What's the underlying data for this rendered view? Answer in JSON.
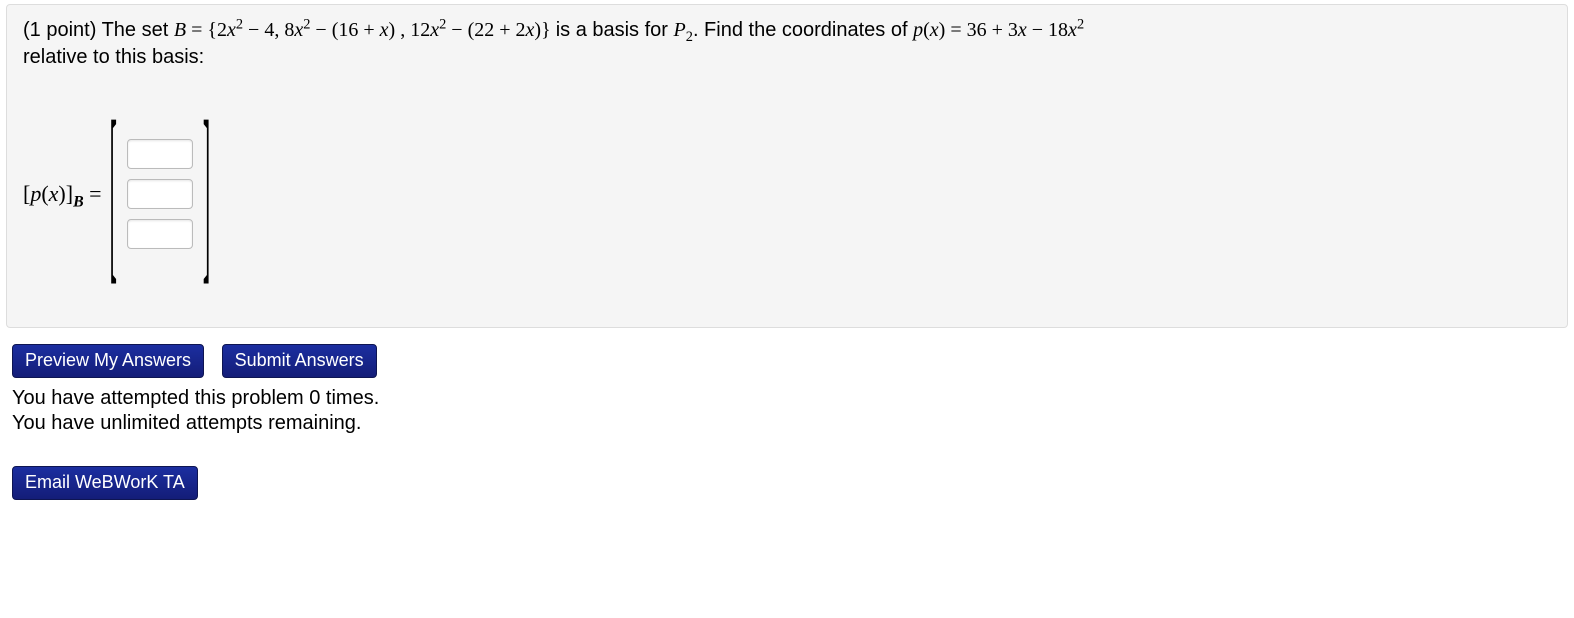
{
  "problem": {
    "points_prefix": "(1 point) ",
    "lead": "The set ",
    "B_eq": "B",
    "set_open": " = {",
    "b1_a": "2",
    "b1_b": " − 4,  ",
    "b2_a": "8",
    "b2_b": " − (16 + ",
    "b2_c": ") ,  ",
    "b3_a": "12",
    "b3_b": " − (22 + 2",
    "b3_c": ")",
    "set_close": "} ",
    "mid": "is a basis for ",
    "space": "P",
    "space_sub": "2",
    "mid2": ". Find the coordinates of ",
    "p_of_x": "p",
    "p_paren_x": "x",
    "eq": " = 36 + 3",
    "eq_x": "x",
    "eq_m": " − 18",
    "tail": " relative to this basis:",
    "vec_label_open": "[",
    "vec_label_p": "p",
    "vec_label_x": "x",
    "vec_label_close": "]",
    "vec_label_sub": "B",
    "vec_label_eq": " ="
  },
  "answers": {
    "c1": "",
    "c2": "",
    "c3": ""
  },
  "buttons": {
    "preview": "Preview My Answers",
    "submit": "Submit Answers",
    "email": "Email WeBWorK TA"
  },
  "status": {
    "line1": "You have attempted this problem 0 times.",
    "line2": "You have unlimited attempts remaining."
  }
}
